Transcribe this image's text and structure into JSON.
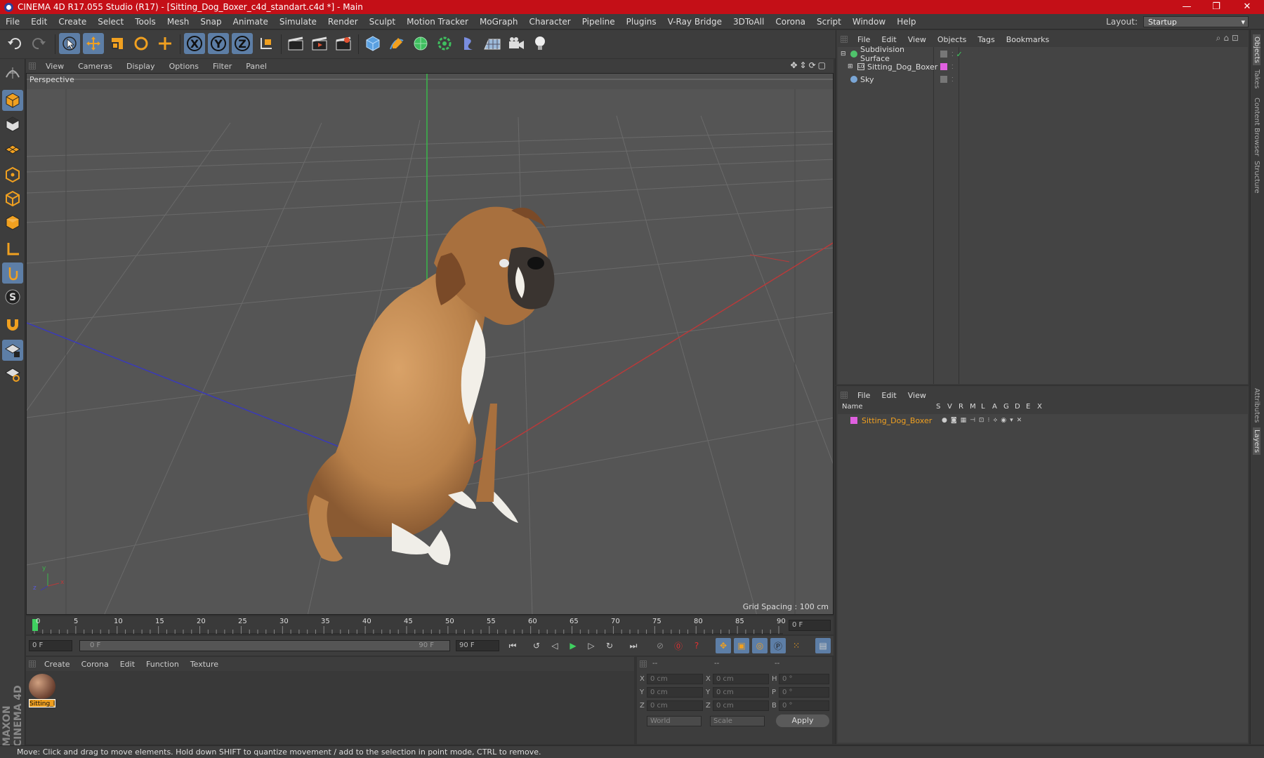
{
  "window": {
    "title": "CINEMA 4D R17.055 Studio (R17) - [Sitting_Dog_Boxer_c4d_standart.c4d *] - Main",
    "minimize": "—",
    "maximize": "❐",
    "close": "✕"
  },
  "menubar": [
    "File",
    "Edit",
    "Create",
    "Select",
    "Tools",
    "Mesh",
    "Snap",
    "Animate",
    "Simulate",
    "Render",
    "Sculpt",
    "Motion Tracker",
    "MoGraph",
    "Character",
    "Pipeline",
    "Plugins",
    "V-Ray Bridge",
    "3DToAll",
    "Corona",
    "Script",
    "Window",
    "Help"
  ],
  "layout": {
    "label": "Layout:",
    "value": "Startup"
  },
  "toolbar_axes": {
    "x": "X",
    "y": "Y",
    "z": "Z"
  },
  "viewport": {
    "menu": [
      "View",
      "Cameras",
      "Display",
      "Options",
      "Filter",
      "Panel"
    ],
    "label": "Perspective",
    "grid_spacing": "Grid Spacing : 100 cm",
    "axis_labels": {
      "x": "x",
      "y": "y",
      "z": "z"
    }
  },
  "timeline": {
    "ticks": [
      "0",
      "5",
      "10",
      "15",
      "20",
      "25",
      "30",
      "35",
      "40",
      "45",
      "50",
      "55",
      "60",
      "65",
      "70",
      "75",
      "80",
      "85",
      "90"
    ],
    "current_frame": "0 F",
    "start_field": "0 F",
    "range_start": "0 F",
    "range_end": "90 F",
    "end_field": "90 F"
  },
  "material_panel": {
    "menu": [
      "Create",
      "Corona",
      "Edit",
      "Function",
      "Texture"
    ],
    "materials": [
      {
        "label": "Sitting_I"
      }
    ]
  },
  "coordinates": {
    "headers": [
      "--",
      "--",
      "--"
    ],
    "rows": [
      {
        "a": "X",
        "av": "0 cm",
        "b": "X",
        "bv": "0 cm",
        "c": "H",
        "cv": "0 °"
      },
      {
        "a": "Y",
        "av": "0 cm",
        "b": "Y",
        "bv": "0 cm",
        "c": "P",
        "cv": "0 °"
      },
      {
        "a": "Z",
        "av": "0 cm",
        "b": "Z",
        "bv": "0 cm",
        "c": "B",
        "cv": "0 °"
      }
    ],
    "mode1": "World",
    "mode2": "Scale",
    "apply": "Apply"
  },
  "objects_panel": {
    "menu": [
      "File",
      "Edit",
      "View",
      "Objects",
      "Tags",
      "Bookmarks"
    ],
    "items": [
      {
        "name": "Subdivision Surface",
        "color": "#4fc36b"
      },
      {
        "name": "Sitting_Dog_Boxer",
        "color": "#e060e0"
      },
      {
        "name": "Sky",
        "color": "#7aa6d6"
      }
    ]
  },
  "layers_panel": {
    "menu": [
      "File",
      "Edit",
      "View"
    ],
    "columns": [
      "Name",
      "S",
      "V",
      "R",
      "M",
      "L",
      "A",
      "G",
      "D",
      "E",
      "X"
    ],
    "layers": [
      {
        "name": "Sitting_Dog_Boxer",
        "color": "#e060e0"
      }
    ]
  },
  "right_tabs": [
    "Objects",
    "Takes",
    "Content Browser",
    "Structure",
    "Attributes",
    "Layers"
  ],
  "status": "Move: Click and drag to move elements. Hold down SHIFT to quantize movement / add to the selection in point mode, CTRL to remove.",
  "brand": "MAXON CINEMA 4D",
  "colors": {
    "title_bg": "#c40f17",
    "selected": "#5d7ea6",
    "accent_orange": "#f0a020"
  }
}
